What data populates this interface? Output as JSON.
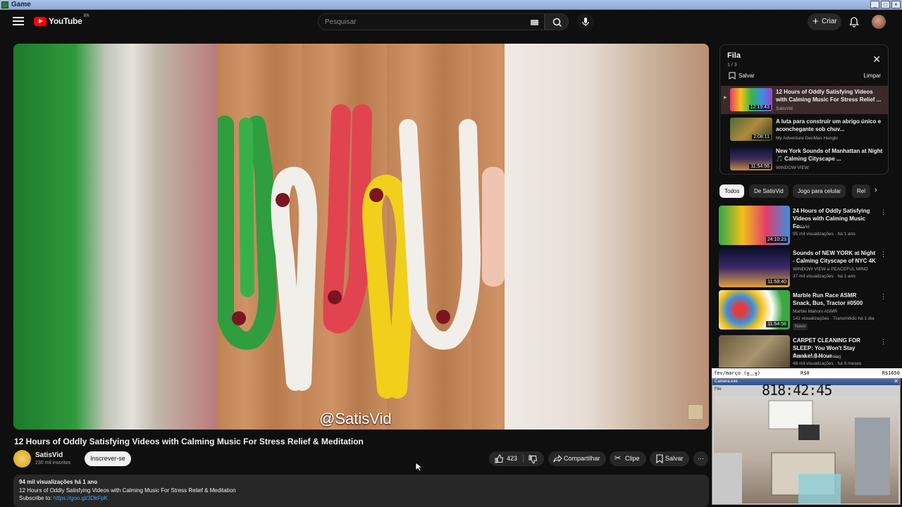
{
  "window": {
    "title": "Game",
    "buttons": [
      "_",
      "□",
      "×"
    ]
  },
  "masthead": {
    "logo_text": "YouTube",
    "country": "BR",
    "search_placeholder": "Pesquisar",
    "create_label": "Criar"
  },
  "video": {
    "watermark": "@SatisVid",
    "title": "12 Hours of Oddly Satisfying Videos with Calming Music For Stress Relief & Meditation",
    "channel": "SatisVid",
    "subscribers": "230 mil inscritos",
    "subscribe_label": "Inscrever-se",
    "likes": "423",
    "share_label": "Compartilhar",
    "clip_label": "Clipe",
    "save_label": "Salvar",
    "views_line": "94 mil visualizações  há 1 ano",
    "desc_line": "12 Hours of Oddly Satisfying Videos with Calming Music For Stress Relief & Meditation",
    "subscribe_prefix": "Subscribe to: ",
    "subscribe_link": "https://goo.gl/3DkFpK"
  },
  "queue": {
    "title": "Fila",
    "count": "1 / 3",
    "save_label": "Salvar",
    "clear_label": "Limpar",
    "items": [
      {
        "title": "12 Hours of Oddly Satisfying Videos with Calming Music For Stress Relief ...",
        "channel": "SatisVid",
        "duration": "12:19:43"
      },
      {
        "title": "A luta para construir um abrigo único e aconchegante sob chuv...",
        "channel": "My Adventure DenMas Hengki",
        "duration": "2:08:11"
      },
      {
        "title": "New York Sounds of Manhattan at Night 🎵 Calming Cityscape ...",
        "channel": "WINDOW VIEW",
        "duration": "11:54:56"
      }
    ]
  },
  "chips": [
    "Todos",
    "De SatisVid",
    "Jogo para celular",
    "Rel"
  ],
  "recommendations": [
    {
      "title": "24 Hours of Oddly Satisfying Videos with Calming Music Fo...",
      "channel": "SatisVid",
      "meta": "95 mil visualizações · há 1 ano",
      "duration": "24:10:23",
      "badge": ""
    },
    {
      "title": "Sounds of NEW YORK at Night - Calming Cityscape of NYC 4K",
      "channel": "WINDOW VIEW e PEACEFUL MIND",
      "meta": "37 mil visualizações · há 1 ano",
      "duration": "11:58:40",
      "badge": ""
    },
    {
      "title": "Marble Run Race ASMR Snack, Bus, Tractor #0500",
      "channel": "Marble Mahoni ASMR",
      "meta": "141 visualizações · Transmitido há 1 dia",
      "duration": "11:54:58",
      "badge": "Novo"
    },
    {
      "title": "CARPET CLEANING FOR SLEEP: You Won't Stay Awake! 8 Hour ...",
      "channel": "Master Carpet Cleaning",
      "meta": "48 mil visualizações · há 9 meses",
      "duration": "",
      "badge": ""
    }
  ],
  "overlay": {
    "left": "fev/março (╥﹏╥)",
    "mid": "R$0",
    "right": "R$1650"
  },
  "camera": {
    "window_title": "Camera.exe",
    "file": "File",
    "clock": "818:42:45"
  },
  "colors": {
    "accent": "#ff0000",
    "link": "#3ea6ff",
    "bg": "#0f0f0f"
  }
}
